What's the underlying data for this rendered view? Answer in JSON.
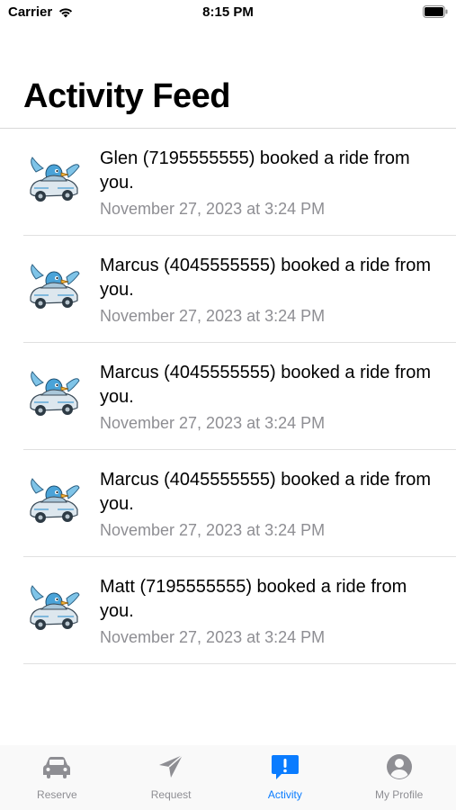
{
  "status_bar": {
    "carrier": "Carrier",
    "time": "8:15 PM",
    "icons": [
      "wifi-icon",
      "battery-icon"
    ]
  },
  "page": {
    "title": "Activity Feed"
  },
  "feed": [
    {
      "message": "Glen (7195555555) booked a ride from you.",
      "time": "November 27, 2023 at 3:24 PM",
      "avatar": "bird-driving-car-art"
    },
    {
      "message": "Marcus  (4045555555) booked a ride from you.",
      "time": "November 27, 2023 at 3:24 PM",
      "avatar": "bird-driving-car-art"
    },
    {
      "message": "Marcus  (4045555555) booked a ride from you.",
      "time": "November 27, 2023 at 3:24 PM",
      "avatar": "bird-driving-car-art"
    },
    {
      "message": "Marcus  (4045555555) booked a ride from you.",
      "time": "November 27, 2023 at 3:24 PM",
      "avatar": "bird-driving-car-art"
    },
    {
      "message": "Matt (7195555555) booked a ride from you.",
      "time": "November 27, 2023 at 3:24 PM",
      "avatar": "bird-driving-car-art"
    }
  ],
  "tab_bar": {
    "tabs": [
      {
        "label": "Reserve",
        "icon": "car-icon",
        "active": false
      },
      {
        "label": "Request",
        "icon": "paper-plane-icon",
        "active": false
      },
      {
        "label": "Activity",
        "icon": "exclamation-bubble-icon",
        "active": true
      },
      {
        "label": "My Profile",
        "icon": "person-circle-icon",
        "active": false
      }
    ]
  },
  "colors": {
    "accent": "#0a7cff",
    "inactive": "#8e8e93",
    "secondary_text": "#8e8e93",
    "divider": "#e0e0e0"
  }
}
